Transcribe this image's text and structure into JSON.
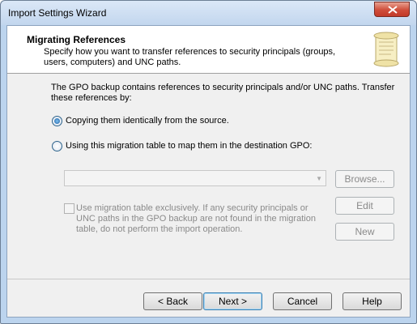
{
  "window": {
    "title": "Import Settings Wizard"
  },
  "header": {
    "title": "Migrating References",
    "description": "Specify how you want to transfer references to security principals (groups, users, computers) and UNC paths.",
    "icon": "scroll-icon"
  },
  "body": {
    "intro": "The GPO backup contains references to security principals and/or UNC paths.  Transfer these references by:",
    "radio_copy": {
      "label": "Copying them identically from the source.",
      "checked": true
    },
    "radio_table": {
      "label": "Using this migration table to map them in the destination GPO:",
      "checked": false
    },
    "migration_table": {
      "value": "",
      "enabled": false
    },
    "browse_label": "Browse...",
    "edit_label": "Edit",
    "new_label": "New",
    "exclusive": {
      "label": "Use migration table exclusively.  If any security principals or UNC paths in the GPO backup are not found in the migration table, do not perform the import operation.",
      "checked": false,
      "enabled": false
    }
  },
  "footer": {
    "back_label": "< Back",
    "next_label": "Next >",
    "cancel_label": "Cancel",
    "help_label": "Help"
  },
  "colors": {
    "close_button": "#c94a37",
    "default_button_border": "#3c7fb1"
  }
}
